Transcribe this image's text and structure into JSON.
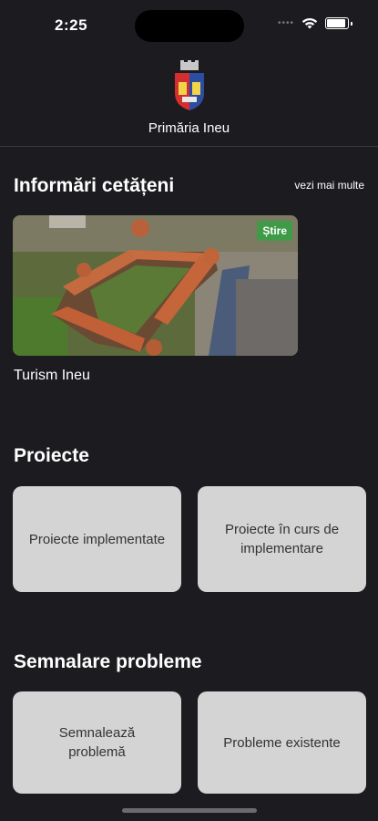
{
  "status": {
    "time": "2:25"
  },
  "header": {
    "town_name": "Primăria Ineu"
  },
  "info_section": {
    "title": "Informări cetățeni",
    "see_more": "vezi mai multe",
    "news": {
      "badge": "Știre",
      "title": "Turism Ineu"
    }
  },
  "projects_section": {
    "title": "Proiecte",
    "tiles": [
      "Proiecte implementate",
      "Proiecte în curs de implementare"
    ]
  },
  "problems_section": {
    "title": "Semnalare probleme",
    "tiles": [
      "Semnalează problemă",
      "Probleme existente"
    ]
  },
  "colors": {
    "background": "#1c1b1f",
    "tile": "#d4d4d4",
    "badge": "#3f9b47"
  },
  "icons": [
    "wifi-icon",
    "battery-icon",
    "crest-logo"
  ]
}
